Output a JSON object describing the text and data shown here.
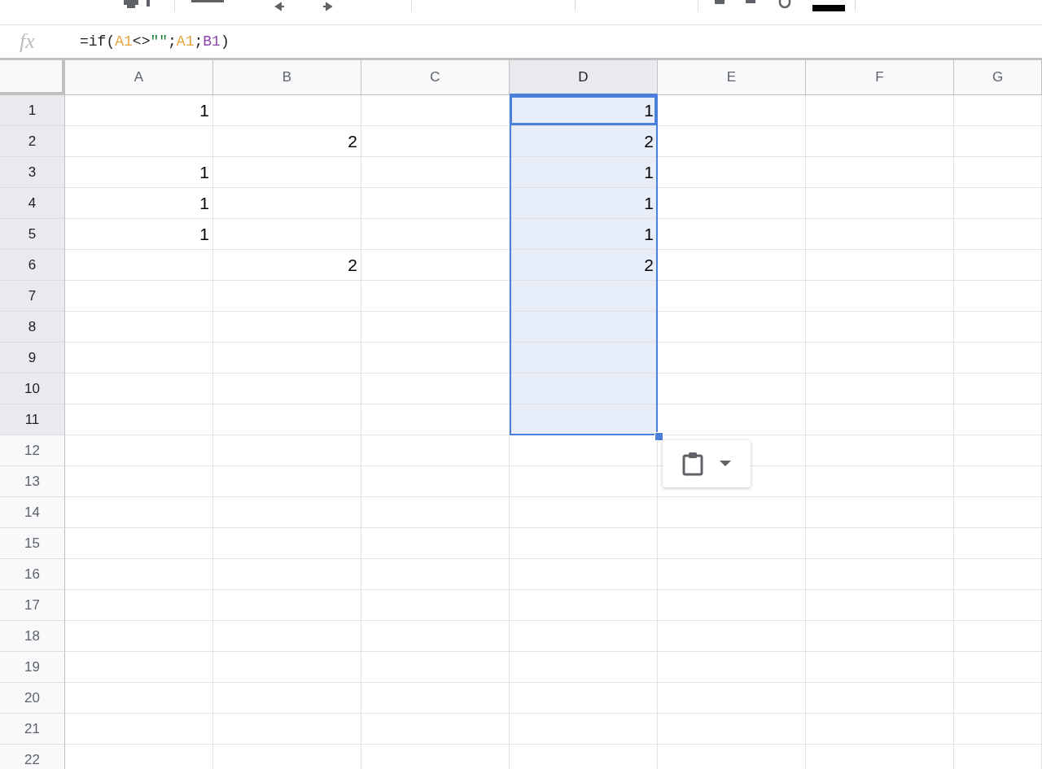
{
  "formula_bar": {
    "label": "fx",
    "parts": [
      {
        "text": "=if(",
        "color": "#202124"
      },
      {
        "text": "A1",
        "color": "#e8a23a"
      },
      {
        "text": "<>",
        "color": "#202124"
      },
      {
        "text": "\"\"",
        "color": "#188038"
      },
      {
        "text": ";",
        "color": "#202124"
      },
      {
        "text": "A1",
        "color": "#e8a23a"
      },
      {
        "text": ";",
        "color": "#202124"
      },
      {
        "text": "B1",
        "color": "#8e44ad"
      },
      {
        "text": ")",
        "color": "#202124"
      }
    ]
  },
  "columns": [
    {
      "label": "A",
      "selected": false
    },
    {
      "label": "B",
      "selected": false
    },
    {
      "label": "C",
      "selected": false
    },
    {
      "label": "D",
      "selected": true
    },
    {
      "label": "E",
      "selected": false
    },
    {
      "label": "F",
      "selected": false
    },
    {
      "label": "G",
      "selected": false
    }
  ],
  "rows": [
    {
      "label": "1",
      "selected": true,
      "active": true,
      "cells": [
        {
          "value": "1"
        },
        {},
        {},
        {
          "value": "1"
        },
        {},
        {},
        {}
      ]
    },
    {
      "label": "2",
      "selected": true,
      "cells": [
        {},
        {
          "value": "2"
        },
        {},
        {
          "value": "2"
        },
        {},
        {},
        {}
      ]
    },
    {
      "label": "3",
      "selected": true,
      "cells": [
        {
          "value": "1"
        },
        {},
        {},
        {
          "value": "1"
        },
        {},
        {},
        {}
      ]
    },
    {
      "label": "4",
      "selected": true,
      "cells": [
        {
          "value": "1"
        },
        {},
        {},
        {
          "value": "1"
        },
        {},
        {},
        {}
      ]
    },
    {
      "label": "5",
      "selected": true,
      "cells": [
        {
          "value": "1"
        },
        {},
        {},
        {
          "value": "1"
        },
        {},
        {},
        {}
      ]
    },
    {
      "label": "6",
      "selected": true,
      "cells": [
        {},
        {
          "value": "2"
        },
        {},
        {
          "value": "2"
        },
        {},
        {},
        {}
      ]
    },
    {
      "label": "7",
      "selected": true,
      "cells": [
        {},
        {},
        {},
        {},
        {},
        {},
        {}
      ]
    },
    {
      "label": "8",
      "selected": true,
      "cells": [
        {},
        {},
        {},
        {},
        {},
        {},
        {}
      ]
    },
    {
      "label": "9",
      "selected": true,
      "cells": [
        {},
        {},
        {},
        {},
        {},
        {},
        {}
      ]
    },
    {
      "label": "10",
      "selected": true,
      "cells": [
        {},
        {},
        {},
        {},
        {},
        {},
        {}
      ]
    },
    {
      "label": "11",
      "selected": true,
      "cells": [
        {},
        {},
        {},
        {},
        {},
        {},
        {}
      ]
    },
    {
      "label": "12",
      "selected": false,
      "cells": [
        {},
        {},
        {},
        {},
        {},
        {},
        {}
      ]
    },
    {
      "label": "13",
      "selected": false,
      "cells": [
        {},
        {},
        {},
        {},
        {},
        {},
        {}
      ]
    },
    {
      "label": "14",
      "selected": false,
      "cells": [
        {},
        {},
        {},
        {},
        {},
        {},
        {}
      ]
    },
    {
      "label": "15",
      "selected": false,
      "cells": [
        {},
        {},
        {},
        {},
        {},
        {},
        {}
      ]
    },
    {
      "label": "16",
      "selected": false,
      "cells": [
        {},
        {},
        {},
        {},
        {},
        {},
        {}
      ]
    },
    {
      "label": "17",
      "selected": false,
      "cells": [
        {},
        {},
        {},
        {},
        {},
        {},
        {}
      ]
    },
    {
      "label": "18",
      "selected": false,
      "cells": [
        {},
        {},
        {},
        {},
        {},
        {},
        {}
      ]
    },
    {
      "label": "19",
      "selected": false,
      "cells": [
        {},
        {},
        {},
        {},
        {},
        {},
        {}
      ]
    },
    {
      "label": "20",
      "selected": false,
      "cells": [
        {},
        {},
        {},
        {},
        {},
        {},
        {}
      ]
    },
    {
      "label": "21",
      "selected": false,
      "cells": [
        {},
        {},
        {},
        {},
        {},
        {},
        {}
      ]
    },
    {
      "label": "22",
      "selected": false,
      "cells": [
        {},
        {},
        {},
        {},
        {},
        {},
        {}
      ]
    }
  ]
}
